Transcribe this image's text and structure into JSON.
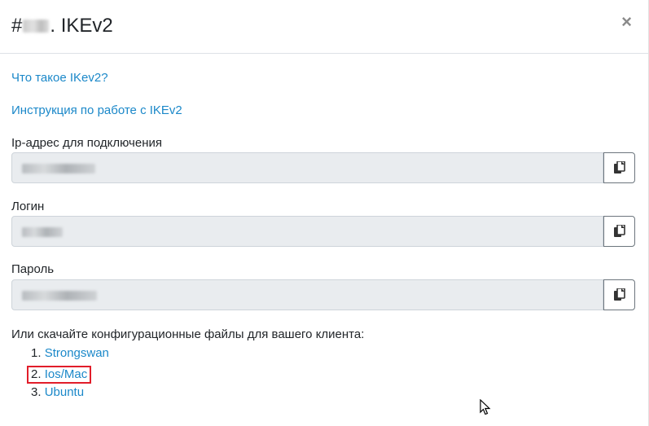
{
  "modal": {
    "title_prefix": "#",
    "title_suffix": ". IKEv2",
    "close_label": "×"
  },
  "links": {
    "what_is": "Что такое IKev2?",
    "instruction": "Инструкция по работе с IKEv2"
  },
  "fields": [
    {
      "label": "Ip-адрес для подключения",
      "value": ""
    },
    {
      "label": "Логин",
      "value": ""
    },
    {
      "label": "Пароль",
      "value": ""
    }
  ],
  "download": {
    "text": "Или скачайте конфигурационные файлы для вашего клиента:",
    "items": [
      {
        "num": "1.",
        "label": "Strongswan"
      },
      {
        "num": "2.",
        "label": "Ios/Mac"
      },
      {
        "num": "3.",
        "label": "Ubuntu"
      }
    ]
  },
  "icons": {
    "copy": "copy-icon",
    "close": "close-icon",
    "cursor": "mouse-cursor-icon"
  },
  "colors": {
    "link": "#1b88c9",
    "highlight": "#e11d2a",
    "input_bg": "#e9ecef"
  }
}
